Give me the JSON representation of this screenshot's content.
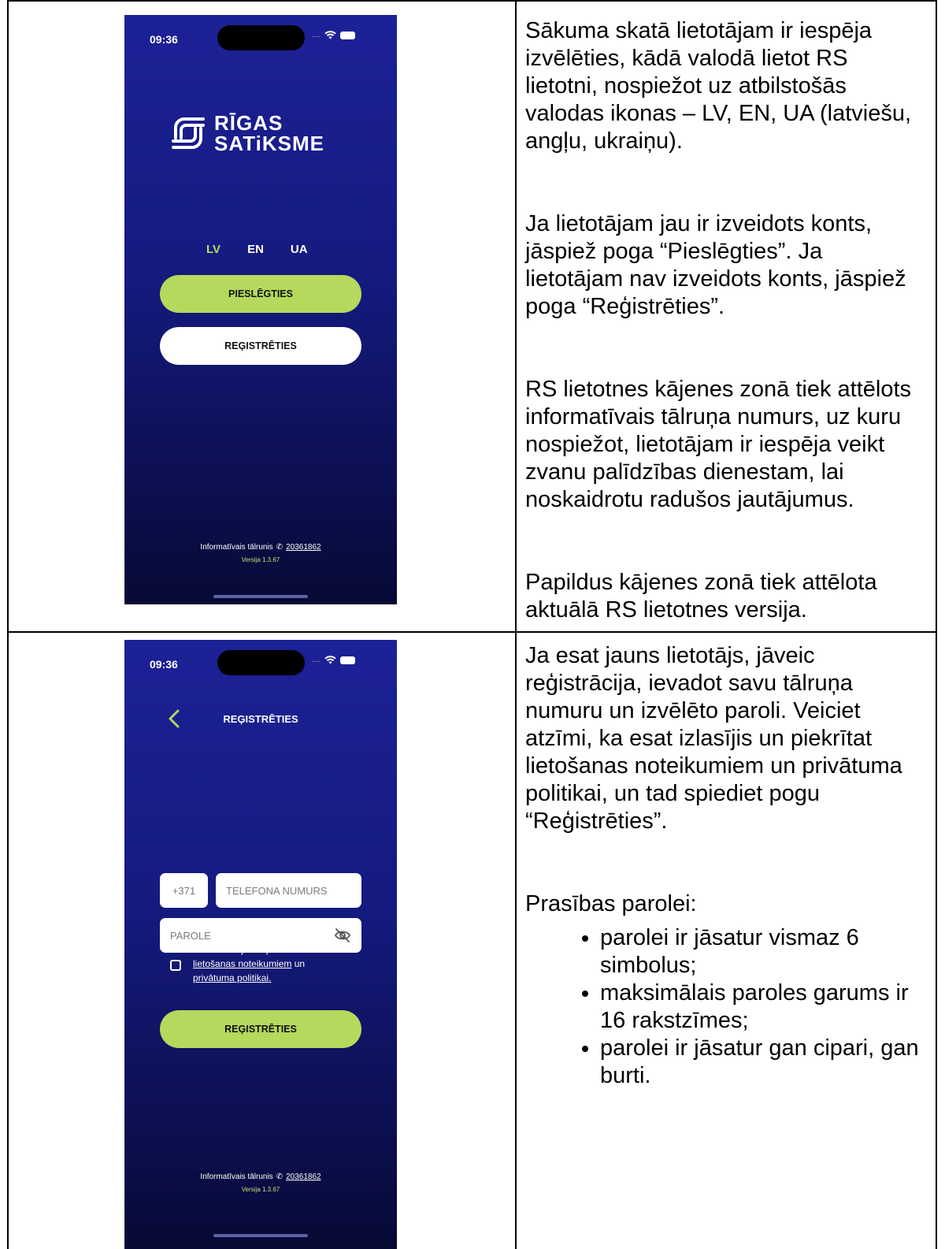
{
  "row1": {
    "phone": {
      "status_time": "09:36",
      "logo_line1": "RĪGAS",
      "logo_line2": "SATiKSME",
      "languages": [
        "LV",
        "EN",
        "UA"
      ],
      "login_button": "PIESLĒGTIES",
      "register_button": "REĢISTRĒTIES",
      "footer_info_label": "Informatīvais tālrunis",
      "footer_phone": "20361862",
      "footer_version": "Versija 1.3.67"
    },
    "description": [
      "Sākuma skatā lietotājam ir iespēja izvēlēties, kādā valodā lietot RS lietotni, nospiežot uz atbilstošās valodas ikonas – LV, EN, UA (latviešu, angļu, ukraiņu).",
      "Ja lietotājam jau ir izveidots konts, jāspiež poga “Pieslēgties”. Ja lietotājam nav izveidots konts, jāspiež poga “Reģistrēties”.",
      "RS lietotnes kājenes zonā tiek attēlots informatīvais tālruņa numurs, uz kuru nospiežot, lietotājam ir iespēja veikt zvanu palīdzības dienestam, lai noskaidrotu radušos jautājumus.",
      "Papildus kājenes zonā tiek attēlota aktuālā RS lietotnes versija."
    ]
  },
  "row2": {
    "phone": {
      "status_time": "09:36",
      "title": "REĢISTRĒTIES",
      "country_code": "+371",
      "phone_placeholder": "TELEFONA NUMURS",
      "password_placeholder": "PAROLE",
      "consent_line1": "Esmu izlasījis un piekrītu",
      "terms_link": "lietošanas noteikumiem",
      "consent_and": "un",
      "privacy_link": "privātuma politikai.",
      "register_button": "REĢISTRĒTIES",
      "footer_info_label": "Informatīvais tālrunis",
      "footer_phone": "20361862",
      "footer_version": "Versija 1.3.67"
    },
    "description_intro": "Ja esat jauns lietotājs, jāveic reģistrācija, ievadot savu tālruņa numuru un izvēlēto paroli. Veiciet atzīmi, ka esat izlasījis un piekrītat lietošanas noteikumiem un privātuma politikai, un tad spiediet pogu “Reģistrēties”.",
    "requirements_heading": "Prasības parolei:",
    "requirements": [
      "parolei ir jāsatur vismaz 6 simbolus;",
      "maksimālais paroles garums ir 16 rakstzīmes;",
      "parolei ir jāsatur gan cipari, gan burti."
    ]
  }
}
